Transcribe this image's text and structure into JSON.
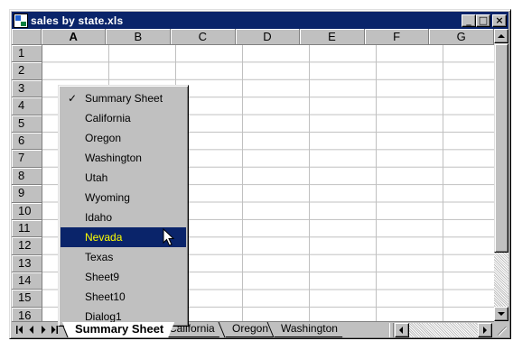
{
  "window": {
    "title": "sales by state.xls",
    "buttons": {
      "minimize": "_",
      "maximize": "□",
      "close": "×"
    }
  },
  "columns": [
    "A",
    "B",
    "C",
    "D",
    "E",
    "F",
    "G"
  ],
  "active_column": "A",
  "rows": [
    "1",
    "2",
    "3",
    "4",
    "5",
    "6",
    "7",
    "8",
    "9",
    "10",
    "11",
    "12",
    "13",
    "14",
    "15",
    "16"
  ],
  "sheet_menu": {
    "items": [
      {
        "label": "Summary Sheet",
        "checked": true
      },
      {
        "label": "California"
      },
      {
        "label": "Oregon"
      },
      {
        "label": "Washington"
      },
      {
        "label": "Utah"
      },
      {
        "label": "Wyoming"
      },
      {
        "label": "Idaho"
      },
      {
        "label": "Nevada",
        "highlighted": true
      },
      {
        "label": "Texas"
      },
      {
        "label": "Sheet9"
      },
      {
        "label": "Sheet10"
      },
      {
        "label": "Dialog1"
      }
    ],
    "check_glyph": "✓"
  },
  "sheet_tabs": [
    {
      "label": "Summary Sheet",
      "active": true
    },
    {
      "label": "California"
    },
    {
      "label": "Oregon"
    },
    {
      "label": "Washington"
    }
  ],
  "colors": {
    "titlebar": "#0a246a",
    "highlight_bg": "#0a246a",
    "highlight_text": "#ffff00",
    "chrome": "#c0c0c0"
  },
  "icons": [
    "excel-app-icon",
    "first-sheet-icon",
    "prev-sheet-icon",
    "next-sheet-icon",
    "last-sheet-icon",
    "arrow-cursor-icon"
  ]
}
